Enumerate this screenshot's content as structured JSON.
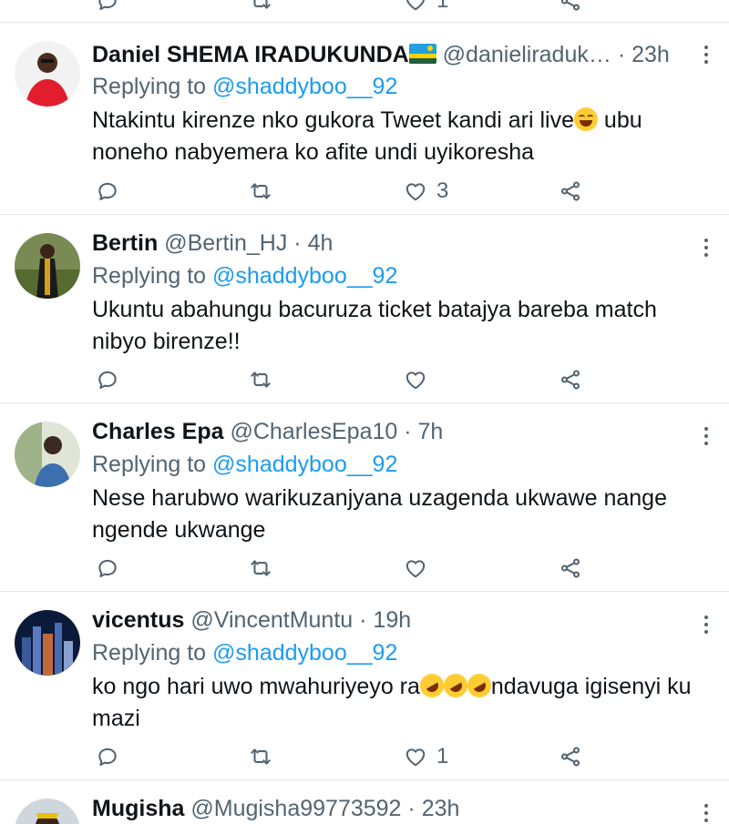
{
  "tweets": [
    {
      "name": "Daniel SHEMA IRADUKUNDA",
      "handle": "@danieliraduk…",
      "sep": "·",
      "time": "23h",
      "replying_prefix": "Replying to",
      "replying_handle": "@shaddyboo__92",
      "text_a": "Ntakintu kirenze nko gukora Tweet kandi ari live",
      "text_b": " ubu noneho nabyemera ko afite undi uyikoresha",
      "likes": "3",
      "retweets": "",
      "replies": ""
    },
    {
      "name": "Bertin",
      "handle": "@Bertin_HJ",
      "sep": "·",
      "time": "4h",
      "replying_prefix": "Replying to",
      "replying_handle": "@shaddyboo__92",
      "text_a": "Ukuntu abahungu bacuruza ticket batajya bareba match nibyo birenze!!",
      "likes": "",
      "retweets": "",
      "replies": ""
    },
    {
      "name": "Charles Epa",
      "handle": "@CharlesEpa10",
      "sep": "·",
      "time": "7h",
      "replying_prefix": "Replying to",
      "replying_handle": "@shaddyboo__92",
      "text_a": "Nese harubwo warikuzanjyana uzagenda ukwawe nange ngende ukwange",
      "likes": "",
      "retweets": "",
      "replies": ""
    },
    {
      "name": "vicentus",
      "handle": "@VincentMuntu",
      "sep": "·",
      "time": "19h",
      "replying_prefix": "Replying to",
      "replying_handle": "@shaddyboo__92",
      "text_a": "ko ngo hari uwo mwahuriyeyo ra",
      "text_b": "ndavuga igisenyi ku mazi",
      "likes": "1",
      "retweets": "",
      "replies": ""
    },
    {
      "name": "Mugisha",
      "handle": "@Mugisha99773592",
      "sep": "·",
      "time": "23h"
    }
  ],
  "top_partial": {
    "likes": "1"
  },
  "icons": {
    "reply": "reply-icon",
    "retweet": "retweet-icon",
    "like": "heart-icon",
    "share": "share-icon",
    "more": "more-icon"
  },
  "colors": {
    "link": "#1d9bf0",
    "muted": "#536471",
    "text": "#0f1419"
  }
}
